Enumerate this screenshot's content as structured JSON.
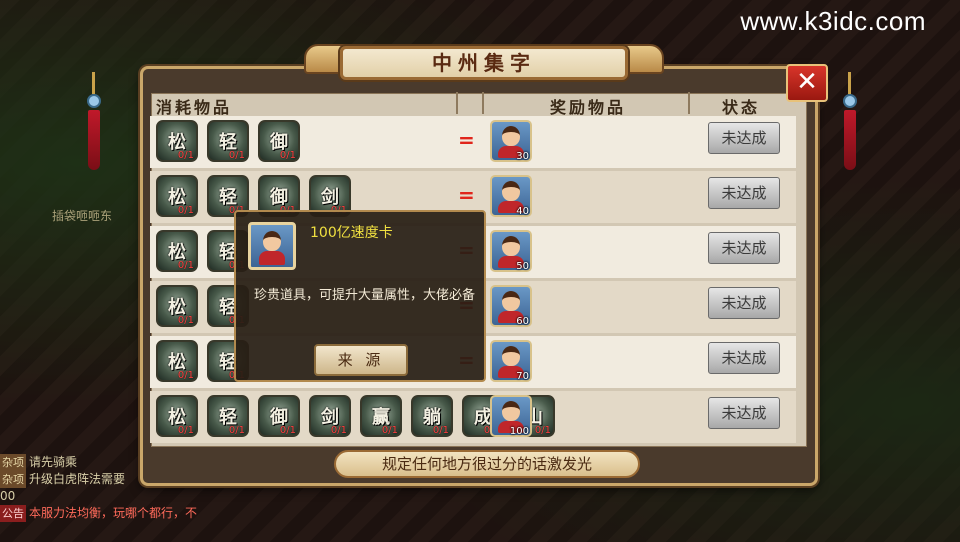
{
  "watermark": "www.k3idc.com",
  "panel": {
    "title": "中州集字",
    "close_label": "✕",
    "headers": {
      "cost": "消耗物品",
      "reward": "奖励物品",
      "status": "状态"
    },
    "footer": "规定任何地方很过分的话激发光"
  },
  "rows": [
    {
      "items": [
        {
          "glyph": "松",
          "count": "0/1"
        },
        {
          "glyph": "轻",
          "count": "0/1"
        },
        {
          "glyph": "御",
          "count": "0/1"
        }
      ],
      "equals": "=",
      "reward_count": "30",
      "status": "未达成"
    },
    {
      "items": [
        {
          "glyph": "松",
          "count": "0/1"
        },
        {
          "glyph": "轻",
          "count": "0/1"
        },
        {
          "glyph": "御",
          "count": "0/1"
        },
        {
          "glyph": "剑",
          "count": "0/1"
        }
      ],
      "equals": "=",
      "reward_count": "40",
      "status": "未达成"
    },
    {
      "items": [
        {
          "glyph": "松",
          "count": "0/1"
        },
        {
          "glyph": "轻",
          "count": "0/1"
        }
      ],
      "equals": "=",
      "reward_count": "50",
      "status": "未达成"
    },
    {
      "items": [
        {
          "glyph": "松",
          "count": "0/1"
        },
        {
          "glyph": "轻",
          "count": "0/1"
        }
      ],
      "equals": "=",
      "reward_count": "60",
      "status": "未达成"
    },
    {
      "items": [
        {
          "glyph": "松",
          "count": "0/1"
        },
        {
          "glyph": "轻",
          "count": "0/1"
        }
      ],
      "equals": "=",
      "reward_count": "70",
      "status": "未达成"
    },
    {
      "items": [
        {
          "glyph": "松",
          "count": "0/1"
        },
        {
          "glyph": "轻",
          "count": "0/1"
        },
        {
          "glyph": "御",
          "count": "0/1"
        },
        {
          "glyph": "剑",
          "count": "0/1"
        },
        {
          "glyph": "赢",
          "count": "0/1"
        },
        {
          "glyph": "躺",
          "count": "0/1"
        },
        {
          "glyph": "成",
          "count": "0/1"
        },
        {
          "glyph": "山",
          "count": "0/1"
        }
      ],
      "equals": "",
      "reward_count": "100",
      "status": "未达成"
    }
  ],
  "tooltip": {
    "item_name": "100亿速度卡",
    "description": "珍贵道具，可提升大量属性，大佬必备",
    "source_button": "来 源"
  },
  "chat": [
    {
      "tag": "杂项",
      "text": "请先骑乘",
      "tag_style": "normal"
    },
    {
      "tag": "杂项",
      "text": "升级白虎阵法需要",
      "tag_style": "normal"
    },
    {
      "tag": "",
      "text": "00",
      "tag_style": "none"
    },
    {
      "tag": "公告",
      "text": "本服力法均衡，玩哪个都行，不",
      "tag_style": "red"
    }
  ],
  "background_label": "插袋咂咂东"
}
